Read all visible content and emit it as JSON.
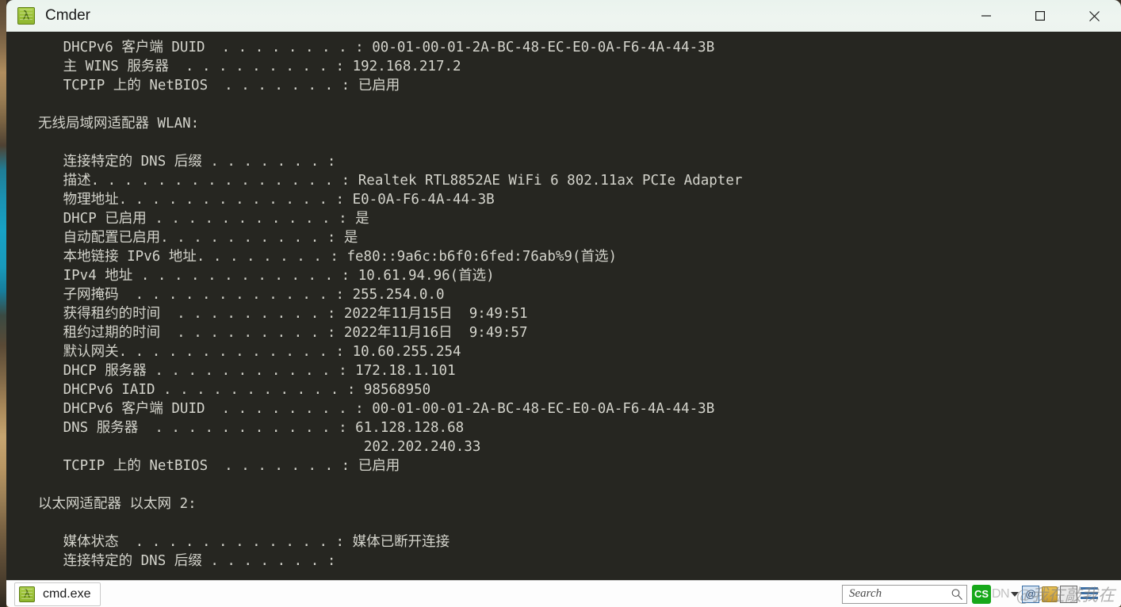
{
  "window": {
    "title": "Cmder",
    "app_icon": "cmder-lambda-icon",
    "controls": {
      "minimize": "minimize-icon",
      "maximize": "maximize-icon",
      "close": "close-icon"
    }
  },
  "terminal": {
    "background_color": "#262621",
    "foreground_color": "#d4d4cc",
    "lines": [
      "   DHCPv6 客户端 DUID  . . . . . . . . : 00-01-00-01-2A-BC-48-EC-E0-0A-F6-4A-44-3B",
      "   主 WINS 服务器  . . . . . . . . . : 192.168.217.2",
      "   TCPIP 上的 NetBIOS  . . . . . . . : 已启用",
      "",
      "无线局域网适配器 WLAN:",
      "",
      "   连接特定的 DNS 后缀 . . . . . . . :",
      "   描述. . . . . . . . . . . . . . . : Realtek RTL8852AE WiFi 6 802.11ax PCIe Adapter",
      "   物理地址. . . . . . . . . . . . . : E0-0A-F6-4A-44-3B",
      "   DHCP 已启用 . . . . . . . . . . . : 是",
      "   自动配置已启用. . . . . . . . . . : 是",
      "   本地链接 IPv6 地址. . . . . . . . : fe80::9a6c:b6f0:6fed:76ab%9(首选)",
      "   IPv4 地址 . . . . . . . . . . . . : 10.61.94.96(首选)",
      "   子网掩码  . . . . . . . . . . . . : 255.254.0.0",
      "   获得租约的时间  . . . . . . . . . : 2022年11月15日  9:49:51",
      "   租约过期的时间  . . . . . . . . . : 2022年11月16日  9:49:57",
      "   默认网关. . . . . . . . . . . . . : 10.60.255.254",
      "   DHCP 服务器 . . . . . . . . . . . : 172.18.1.101",
      "   DHCPv6 IAID . . . . . . . . . . . : 98568950",
      "   DHCPv6 客户端 DUID  . . . . . . . . : 00-01-00-01-2A-BC-48-EC-E0-0A-F6-4A-44-3B",
      "   DNS 服务器  . . . . . . . . . . . : 61.128.128.68",
      "                                       202.202.240.33",
      "   TCPIP 上的 NetBIOS  . . . . . . . : 已启用",
      "",
      "以太网适配器 以太网 2:",
      "",
      "   媒体状态  . . . . . . . . . . . . : 媒体已断开连接",
      "   连接特定的 DNS 后缀 . . . . . . . :"
    ]
  },
  "taskbar": {
    "task_item_label": "cmd.exe",
    "task_item_icon": "cmder-lambda-icon",
    "search": {
      "placeholder": "Search",
      "value": "",
      "icon": "search-magnifier-icon"
    },
    "tray": {
      "csdn_logo_label": "CS",
      "csdn_text": "DN",
      "at_symbol": "@",
      "watermark": "@我在敲我在",
      "icons": [
        "csdn-logo-icon",
        "tray-caret-icon",
        "at-square-icon",
        "lock-icon",
        "document-icon",
        "lines-icon"
      ]
    }
  }
}
